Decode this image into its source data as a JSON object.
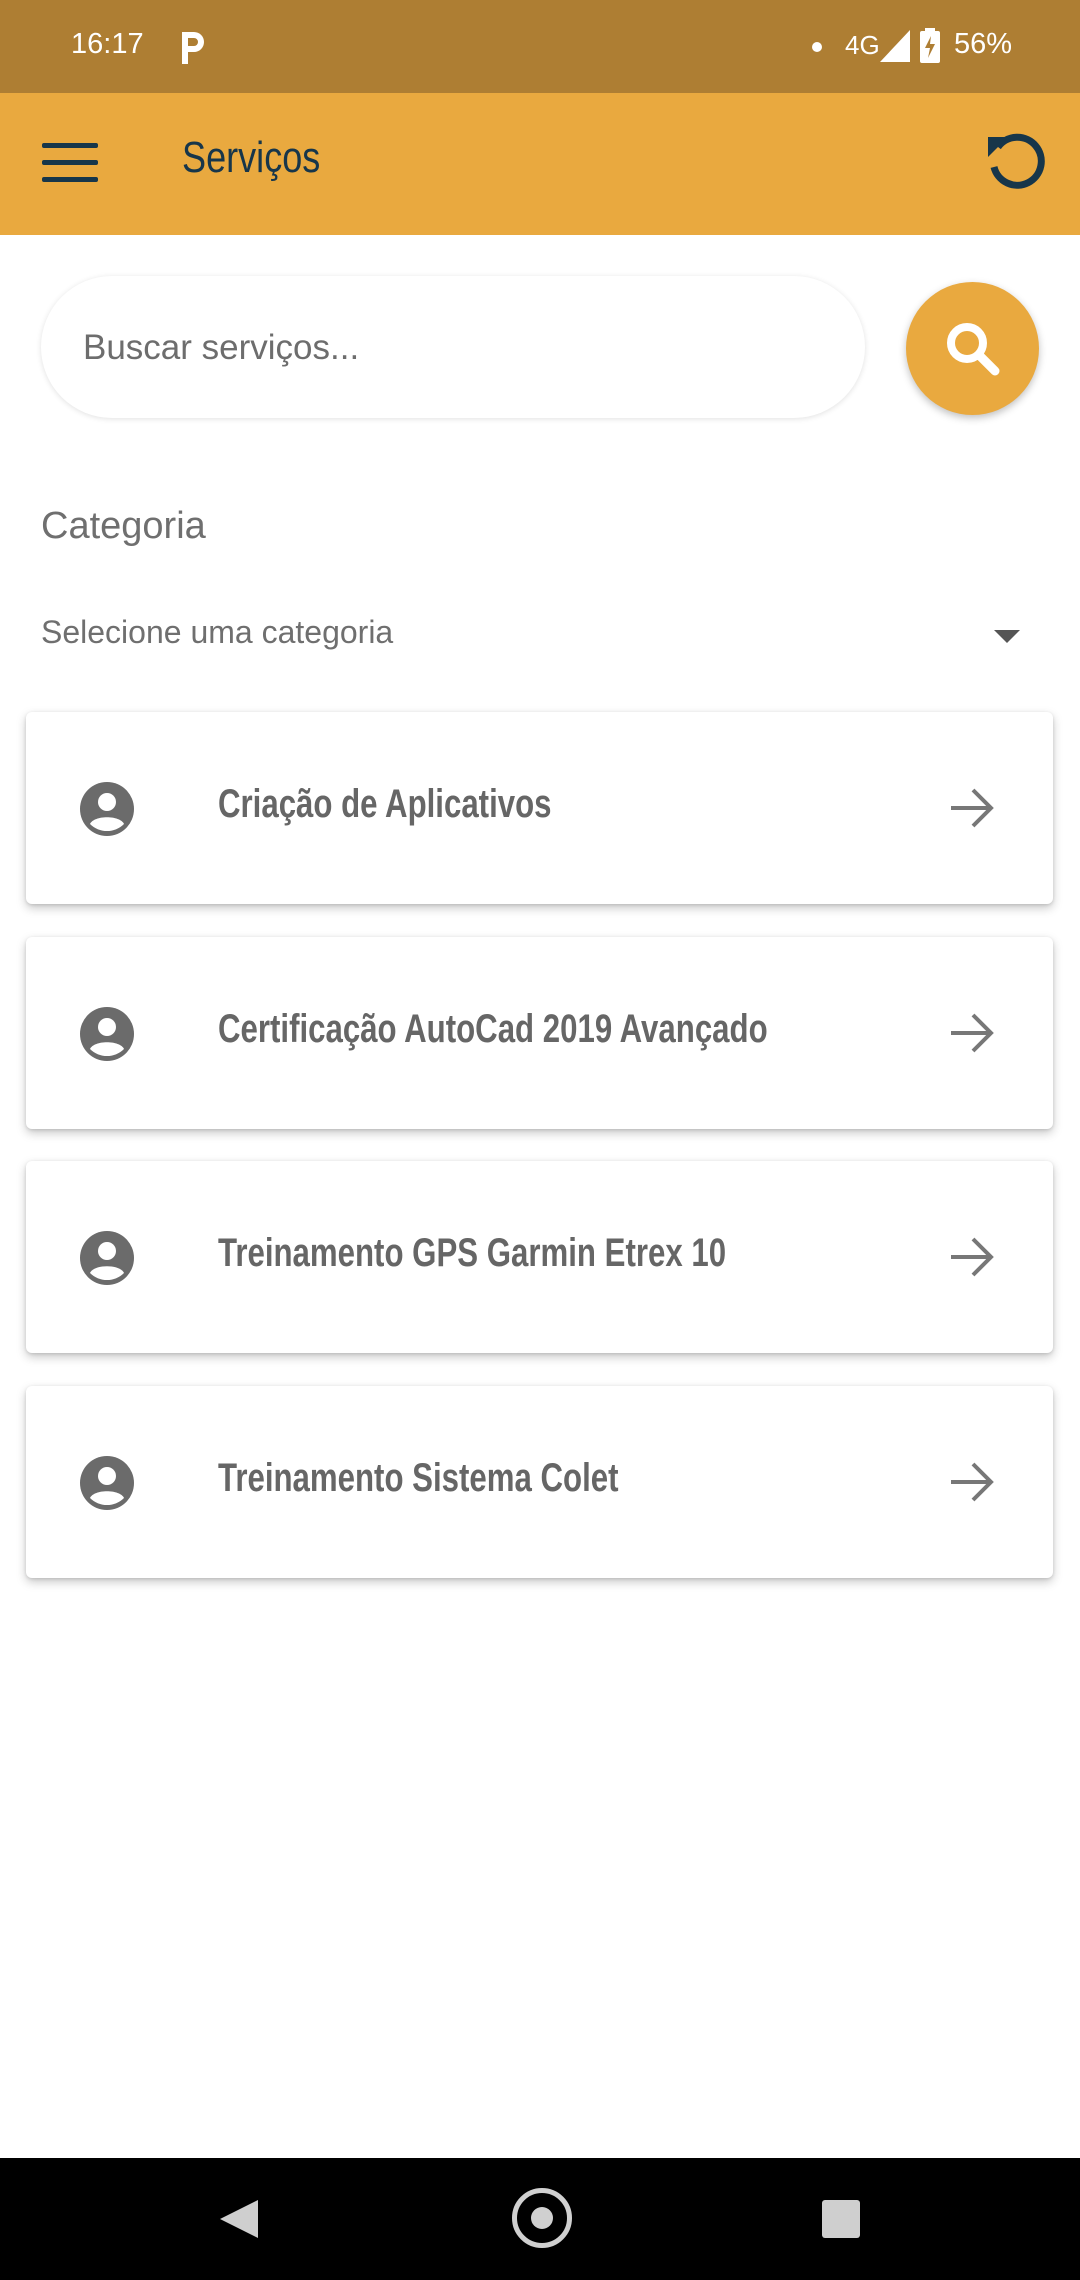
{
  "status_bar": {
    "time": "16:17",
    "network": "4G",
    "battery": "56%"
  },
  "app_bar": {
    "title": "Serviços",
    "background": "#e9a93f",
    "icon_color": "#17364a",
    "icons": [
      "menu-icon",
      "refresh-icon"
    ]
  },
  "search": {
    "placeholder": "Buscar serviços...",
    "value": "",
    "button_icon": "search-icon"
  },
  "category": {
    "label": "Categoria",
    "selected": "Selecione uma categoria"
  },
  "services": [
    {
      "title": "Criação de Aplicativos"
    },
    {
      "title": "Certificação AutoCad 2019 Avançado"
    },
    {
      "title": "Treinamento GPS Garmin Etrex 10"
    },
    {
      "title": "Treinamento Sistema Colet"
    }
  ],
  "colors": {
    "status_bar": "#ae7e33",
    "accent": "#e9a93f",
    "text_dark": "#17364a",
    "card_text": "#666666"
  }
}
